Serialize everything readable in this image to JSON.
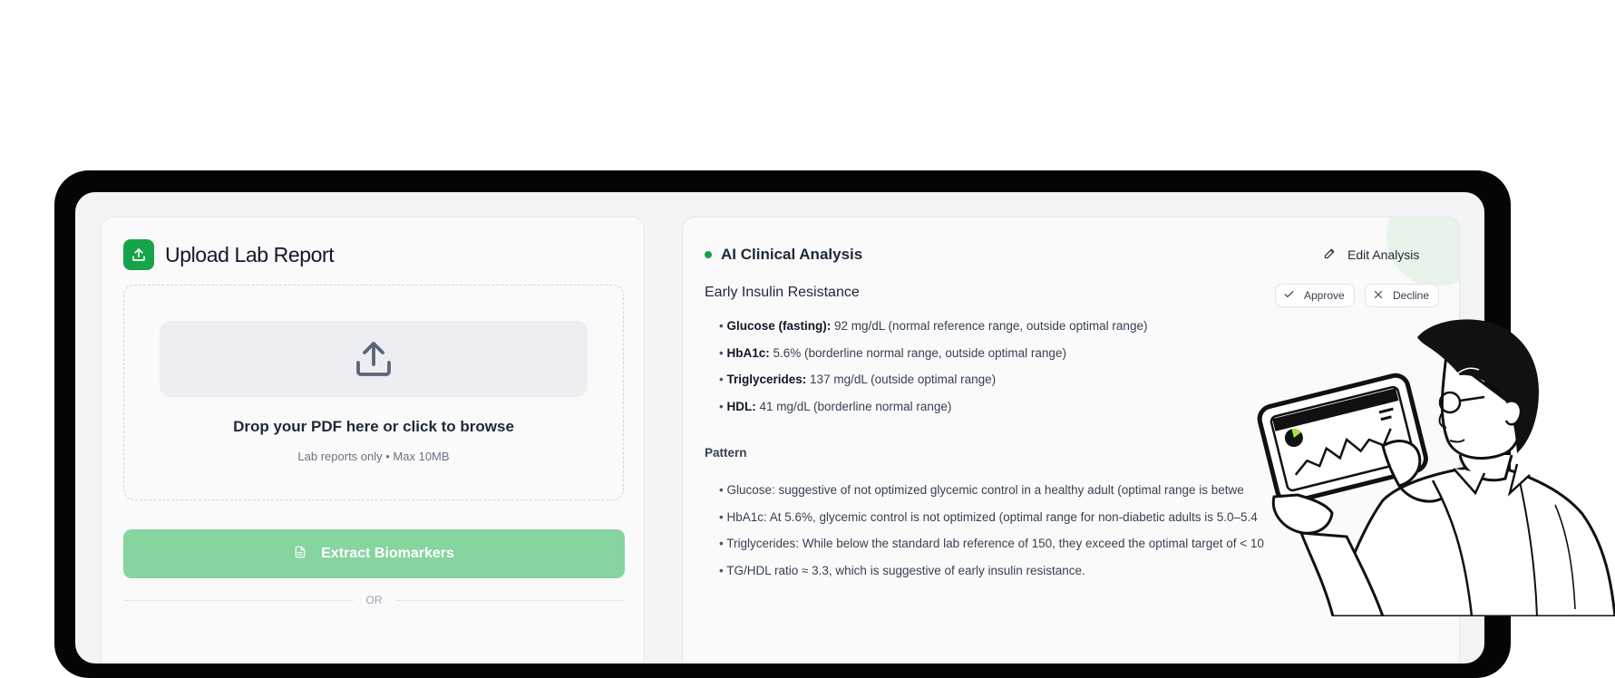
{
  "upload": {
    "title": "Upload Lab Report",
    "drop_main": "Drop your PDF here or click to browse",
    "drop_sub": "Lab reports only • Max 10MB",
    "extract_label": "Extract Biomarkers",
    "or_label": "OR"
  },
  "analysis": {
    "title": "AI Clinical Analysis",
    "edit_label": "Edit Analysis",
    "condition": "Early Insulin Resistance",
    "approve_label": "Approve",
    "decline_label": "Decline",
    "biomarkers": [
      {
        "name": "Glucose (fasting):",
        "value": "92 mg/dL (normal reference range, outside optimal range)"
      },
      {
        "name": "HbA1c:",
        "value": "5.6% (borderline normal range, outside optimal range)"
      },
      {
        "name": "Triglycerides:",
        "value": "137 mg/dL (outside optimal range)"
      },
      {
        "name": "HDL:",
        "value": "41 mg/dL (borderline normal range)"
      }
    ],
    "pattern_title": "Pattern",
    "pattern": [
      "Glucose: suggestive of not optimized glycemic control in a healthy adult (optimal range is betwe",
      "HbA1c: At 5.6%, glycemic control is not optimized (optimal range for non-diabetic adults is 5.0–5.4",
      "Triglycerides: While below the standard lab reference of 150, they exceed the optimal target of < 10",
      "TG/HDL ratio ≈ 3.3, which is suggestive of early insulin resistance."
    ]
  },
  "icons": {
    "upload_badge": "upload-icon",
    "drop": "upload-tray-icon",
    "extract": "document-icon",
    "edit": "pencil-icon",
    "approve": "check-icon",
    "decline": "x-icon"
  },
  "colors": {
    "accent": "#16a34a",
    "extract_button": "#86d4a0",
    "device_frame": "#050505"
  }
}
